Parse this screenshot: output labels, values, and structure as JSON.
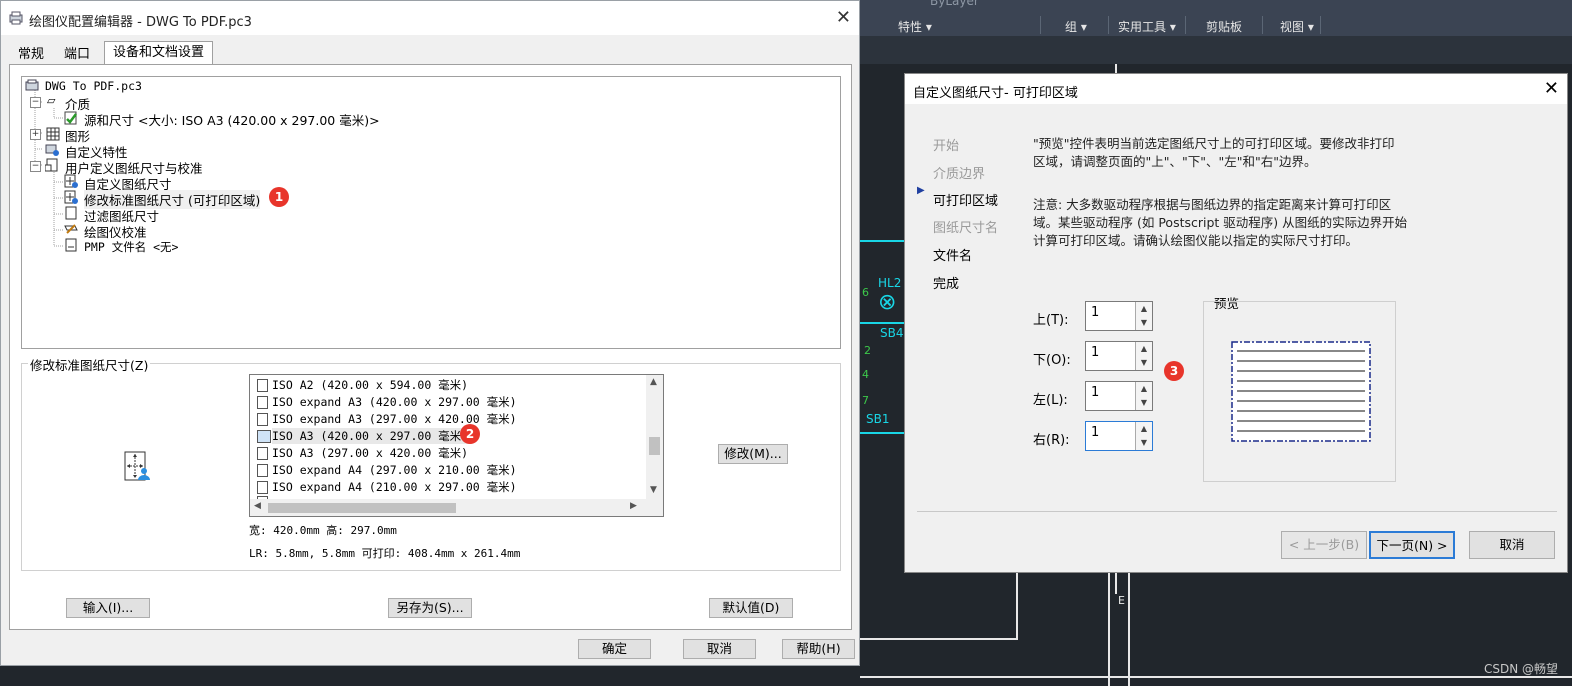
{
  "ribbon": {
    "layer_value": "ByLayer",
    "groups": [
      "特性",
      "组",
      "实用工具",
      "剪贴板",
      "视图"
    ]
  },
  "canvas": {
    "labels": [
      "HL2",
      "SB4",
      "SB1",
      "6",
      "2",
      "4",
      "7",
      "E"
    ]
  },
  "watermark": "CSDN @畅望",
  "dialog1": {
    "title": "绘图仪配置编辑器 - DWG To PDF.pc3",
    "tabs": [
      "常规",
      "端口",
      "设备和文档设置"
    ],
    "active_tab": 2,
    "tree": [
      {
        "label": "DWG To PDF.pc3"
      },
      {
        "label": "介质"
      },
      {
        "label": "源和尺寸 <大小: ISO A3 (420.00 x 297.00 毫米)>"
      },
      {
        "label": "图形"
      },
      {
        "label": "自定义特性"
      },
      {
        "label": "用户定义图纸尺寸与校准"
      },
      {
        "label": "自定义图纸尺寸"
      },
      {
        "label": "修改标准图纸尺寸 (可打印区域)"
      },
      {
        "label": "过滤图纸尺寸"
      },
      {
        "label": "绘图仪校准"
      },
      {
        "label": "PMP 文件名 <无>"
      }
    ],
    "badge1": "1",
    "section_label": "修改标准图纸尺寸(Z)",
    "paper_list": [
      "ISO A2 (420.00 x 594.00 毫米)",
      "ISO expand A3 (420.00 x 297.00 毫米)",
      "ISO expand A3 (297.00 x 420.00 毫米)",
      "ISO A3 (420.00 x 297.00 毫米)",
      "ISO A3 (297.00 x 420.00 毫米)",
      "ISO expand A4 (297.00 x 210.00 毫米)",
      "ISO expand A4 (210.00 x 297.00 毫米)"
    ],
    "selected_index": 3,
    "badge2": "2",
    "modify_button": "修改(M)...",
    "size_info": "宽: 420.0mm 高: 297.0mm",
    "margin_info": "LR: 5.8mm, 5.8mm  可打印: 408.4mm x 261.4mm",
    "import_button": "输入(I)...",
    "saveas_button": "另存为(S)...",
    "default_button": "默认值(D)",
    "ok_button": "确定",
    "cancel_button": "取消",
    "help_button": "帮助(H)"
  },
  "dialog2": {
    "title": "自定义图纸尺寸- 可打印区域",
    "steps": [
      "开始",
      "介质边界",
      "可打印区域",
      "图纸尺寸名",
      "文件名",
      "完成"
    ],
    "current_step": 2,
    "para1": [
      "\"预览\"控件表明当前选定图纸尺寸上的可打印区域。要修改非打印",
      "区域，请调整页面的\"上\"、\"下\"、\"左\"和\"右\"边界。"
    ],
    "para2": [
      "注意: 大多数驱动程序根据与图纸边界的指定距离来计算可打印区",
      "域。某些驱动程序 (如 Postscript 驱动程序) 从图纸的实际边界开始",
      "计算可打印区域。请确认绘图仪能以指定的实际尺寸打印。"
    ],
    "fields": [
      {
        "label": "上(T):",
        "value": "1"
      },
      {
        "label": "下(O):",
        "value": "1"
      },
      {
        "label": "左(L):",
        "value": "1"
      },
      {
        "label": "右(R):",
        "value": "1"
      }
    ],
    "badge3": "3",
    "preview_label": "预览",
    "back_button": "< 上一步(B)",
    "next_button": "下一页(N) >",
    "cancel_button": "取消"
  }
}
